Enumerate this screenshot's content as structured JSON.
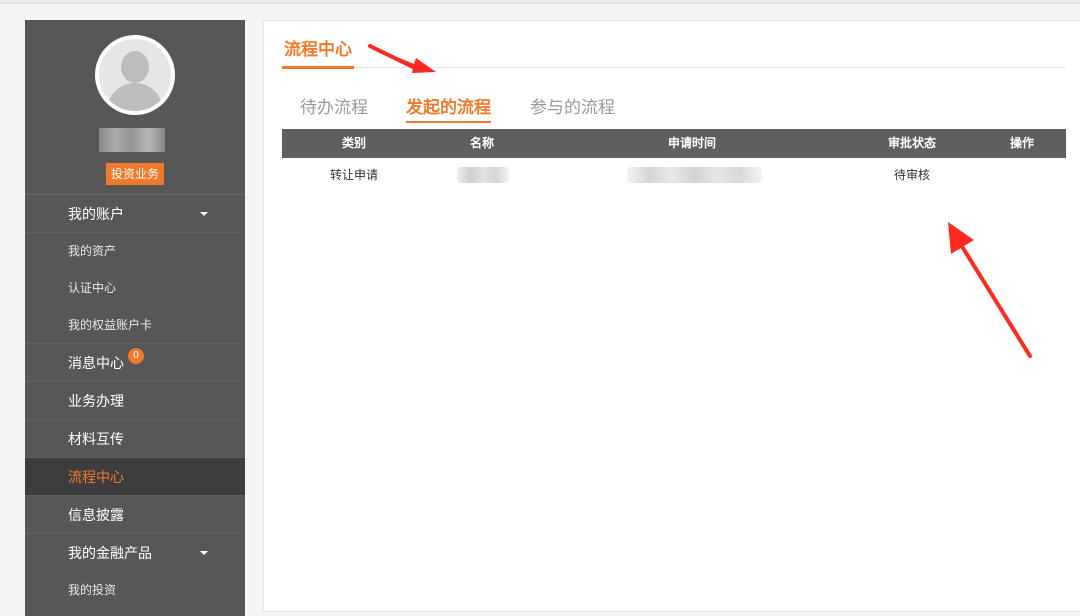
{
  "sidebar": {
    "role_badge": "投资业务",
    "menu": {
      "my_account": "我的账户",
      "my_assets": "我的资产",
      "auth_center": "认证中心",
      "equity_card": "我的权益账户卡",
      "message_center": "消息中心",
      "message_count": "0",
      "business": "业务办理",
      "materials": "材料互传",
      "process_center": "流程中心",
      "disclosure": "信息披露",
      "financial_products": "我的金融产品",
      "my_investment": "我的投资"
    }
  },
  "main": {
    "title": "流程中心",
    "tabs": [
      "待办流程",
      "发起的流程",
      "参与的流程"
    ],
    "active_tab": "发起的流程",
    "table": {
      "columns": [
        "类别",
        "名称",
        "申请时间",
        "审批状态",
        "操作"
      ],
      "rows": [
        {
          "category": "转让申请",
          "name": "",
          "time": "",
          "status": "待审核",
          "action": ""
        }
      ]
    }
  },
  "colors": {
    "accent": "#f07a2b",
    "sidebar_bg": "#575757",
    "table_header_bg": "#5f5f5f",
    "annotation_arrow": "#ff2a1f"
  }
}
